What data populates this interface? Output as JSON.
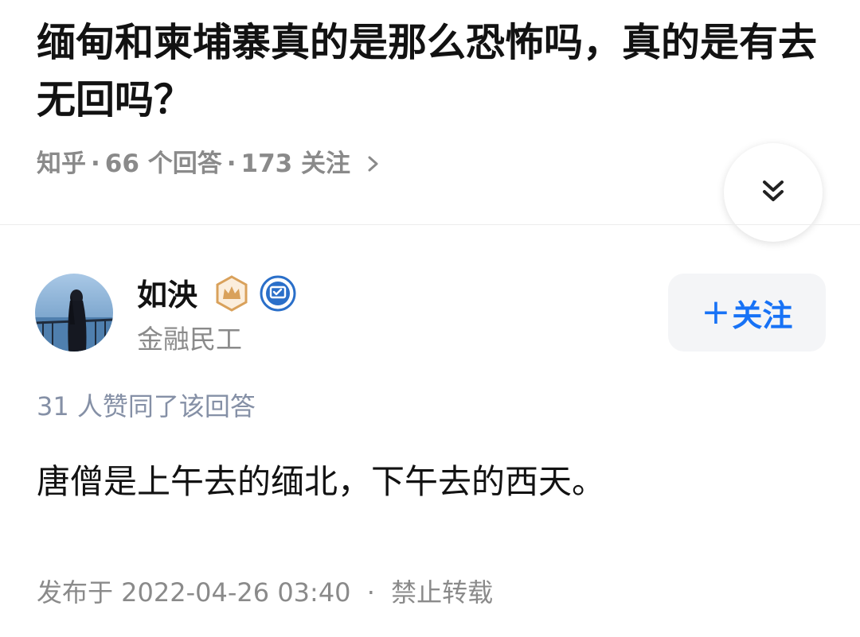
{
  "question": {
    "title": "缅甸和柬埔寨真的是那么恐怖吗，真的是有去无回吗？",
    "source": "知乎",
    "answers_count": "66 个回答",
    "followers_count": "173 关注",
    "separator": "·"
  },
  "icons": {
    "chevron_right": "chevron-right-icon",
    "collapse": "double-chevron-down-icon",
    "crown_badge": "crown-badge-icon",
    "verified_badge": "verified-badge-icon"
  },
  "author": {
    "name": "如泱",
    "title": "金融民工",
    "follow_label": "关注",
    "follow_plus": "+"
  },
  "answer": {
    "vote_text": "31 人赞同了该回答",
    "content": "唐僧是上午去的缅北，下午去的西天。",
    "published": "发布于 2022-04-26 03:40",
    "separator": "·",
    "copyright": "禁止转载"
  },
  "colors": {
    "accent": "#1772f6",
    "title_text": "#121212",
    "meta_text": "#8a8a8a",
    "vote_text": "#8590a6",
    "crown_gold": "#d9a15b",
    "verified_blue": "#2a6fc9"
  }
}
